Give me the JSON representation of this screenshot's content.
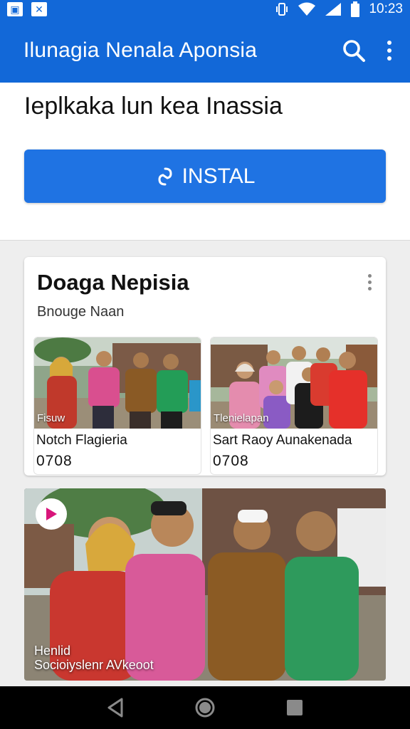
{
  "status_bar": {
    "left_icons": [
      "picture-notification-icon",
      "close-notification-icon"
    ],
    "right_icons": [
      "vibrate-icon",
      "wifi-icon",
      "signal-icon",
      "battery-icon"
    ],
    "time": "10:23"
  },
  "app_bar": {
    "title": "Ilunagia Nenala Aponsia",
    "actions": [
      "search-icon",
      "more-vert-icon"
    ]
  },
  "header": {
    "title": "Ieplkaka lun kea Inassia",
    "install_label": "INSTAL",
    "install_icon": "link-icon"
  },
  "card": {
    "title": "Doaga Nepisia",
    "subtitle": "Bnouge Naan",
    "menu_icon": "more-vert-icon",
    "tiles": [
      {
        "caption": "Fisuw",
        "name": "Notch Flagieria",
        "number": "0708"
      },
      {
        "caption": "Tlenielapan",
        "name": "Sart Raoy Aunakenada",
        "number": "0708"
      }
    ]
  },
  "photo_card": {
    "play_icon": "play-icon",
    "caption_line1": "Henlid",
    "caption_line2": "Socioiyslenr AVkeoot"
  },
  "nav_bar": {
    "items": [
      "back-icon",
      "home-icon",
      "recents-icon"
    ]
  },
  "colors": {
    "primary": "#1268d8",
    "button": "#1f73e3",
    "play_accent": "#d8157a"
  }
}
